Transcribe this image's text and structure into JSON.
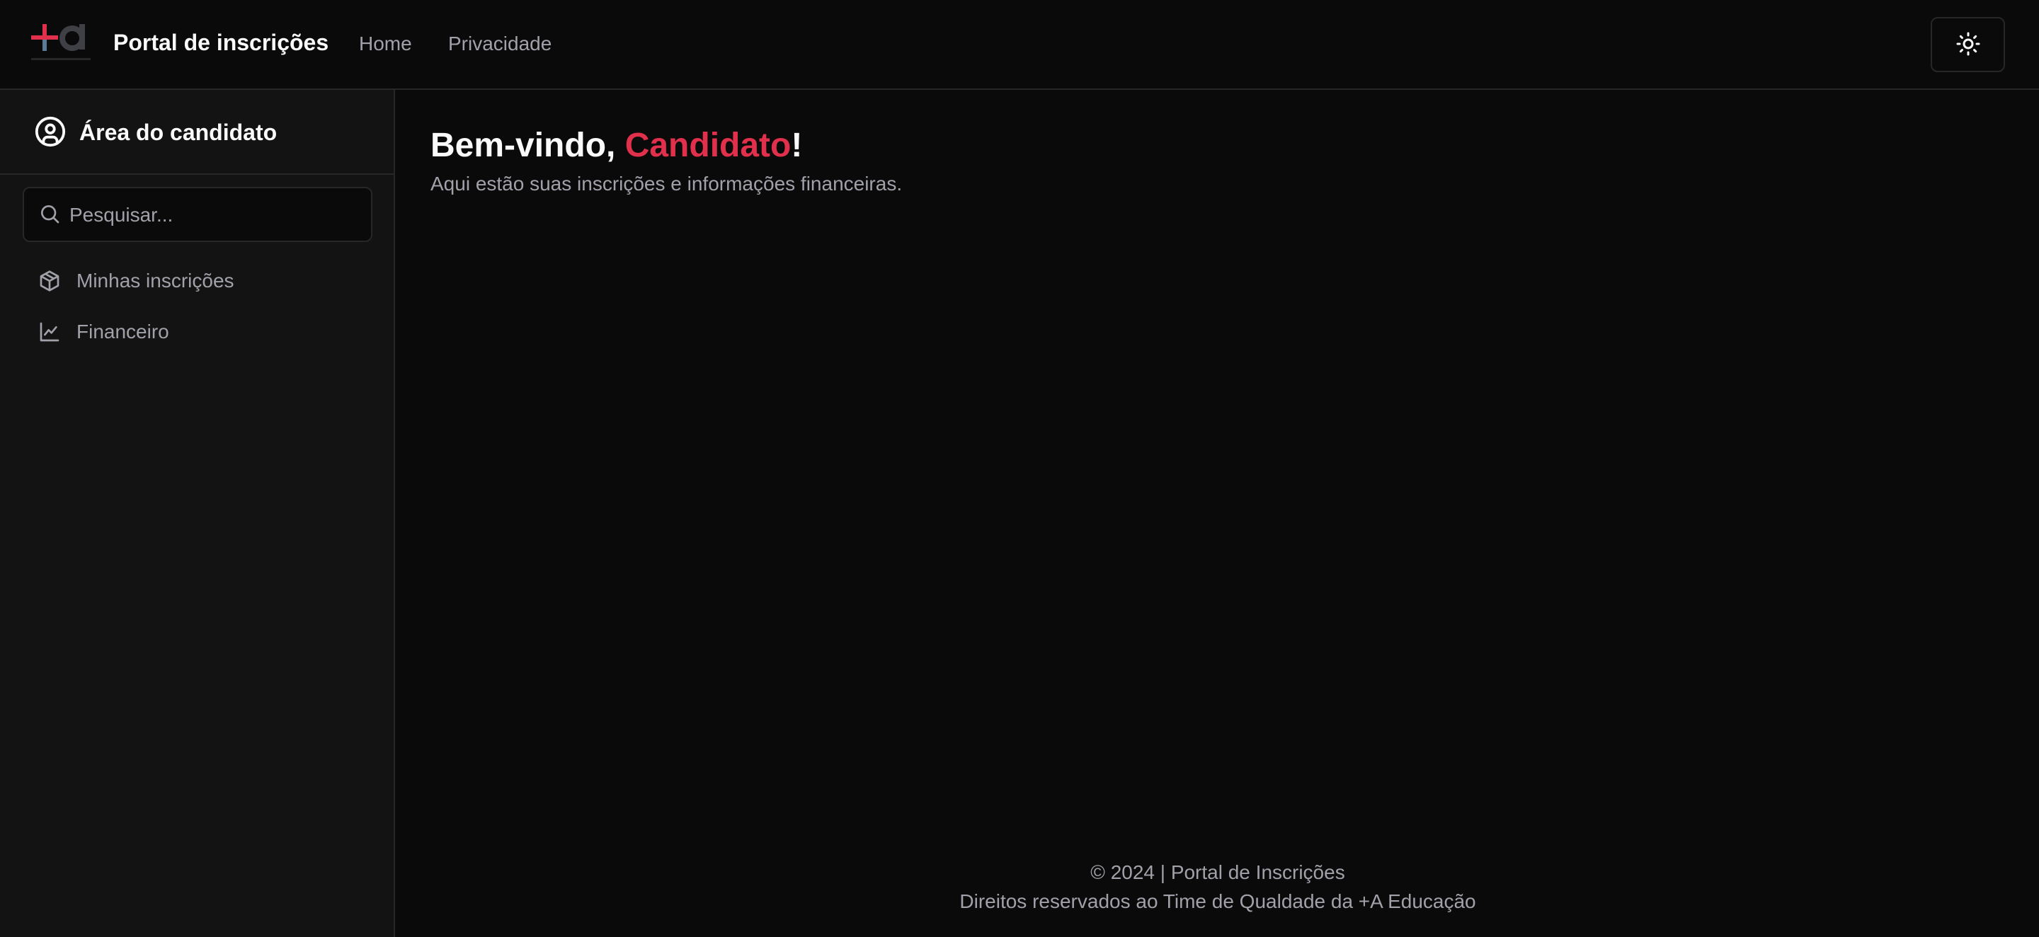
{
  "header": {
    "brand": "Portal de inscrições",
    "nav": [
      {
        "label": "Home"
      },
      {
        "label": "Privacidade"
      }
    ],
    "theme_toggle_icon": "sun-icon",
    "logo_icon": "plus-a-logo-icon"
  },
  "sidebar": {
    "title": "Área do candidato",
    "title_icon": "user-circle-icon",
    "search": {
      "placeholder": "Pesquisar...",
      "value": ""
    },
    "items": [
      {
        "label": "Minhas inscrições",
        "icon": "package-icon"
      },
      {
        "label": "Financeiro",
        "icon": "line-chart-icon"
      }
    ]
  },
  "main": {
    "greeting_prefix": "Bem-vindo, ",
    "greeting_name": "Candidato",
    "greeting_suffix": "!",
    "subtitle": "Aqui estão suas inscrições e informações financeiras."
  },
  "footer": {
    "line1": "© 2024 | Portal de Inscrições",
    "line2": "Direitos reservados ao Time de Qualdade da +A Educação"
  },
  "colors": {
    "background": "#0a0a0a",
    "sidebar": "#131313",
    "border": "#27272a",
    "accent": "#e0304c",
    "muted_text": "#a1a1aa"
  }
}
